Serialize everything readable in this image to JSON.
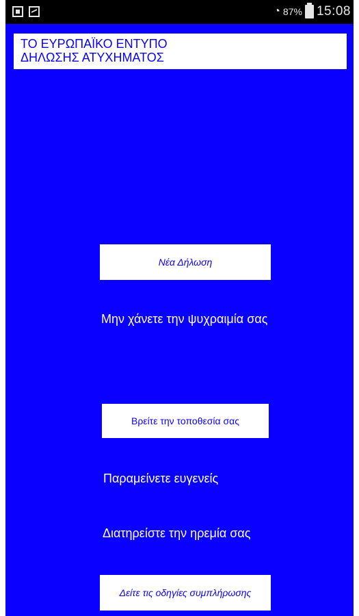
{
  "status_bar": {
    "left_icons": [
      "usb-icon",
      "image-icon"
    ],
    "wifi_icon": "wifi-icon",
    "battery_percent": "87%",
    "battery_icon": "battery-icon",
    "time": "15:08"
  },
  "header": {
    "title_line1": "ΤΟ ΕΥΡΩΠΑΪΚΟ ΕΝΤΥΠΟ",
    "title_line2": "ΔΗΛΩΣΗΣ ΑΤΥΧΗΜΑΤΟΣ"
  },
  "main": {
    "new_declaration_button": "Νέα Δήλωση",
    "message_calm": "Μην χάνετε την ψυχραιμία σας",
    "find_location_button": "Βρείτε την τοποθεσία σας",
    "message_polite": "Παραμείνετε ευγενείς",
    "message_peace": "Διατηρείστε την ηρεμία σας",
    "instructions_button": "Δείτε τις οδηγίες συμπλήρωσης"
  },
  "colors": {
    "background": "#0a00ff",
    "button_background": "#ffffff",
    "button_text": "#0a00ff",
    "message_text": "#ffffff"
  }
}
